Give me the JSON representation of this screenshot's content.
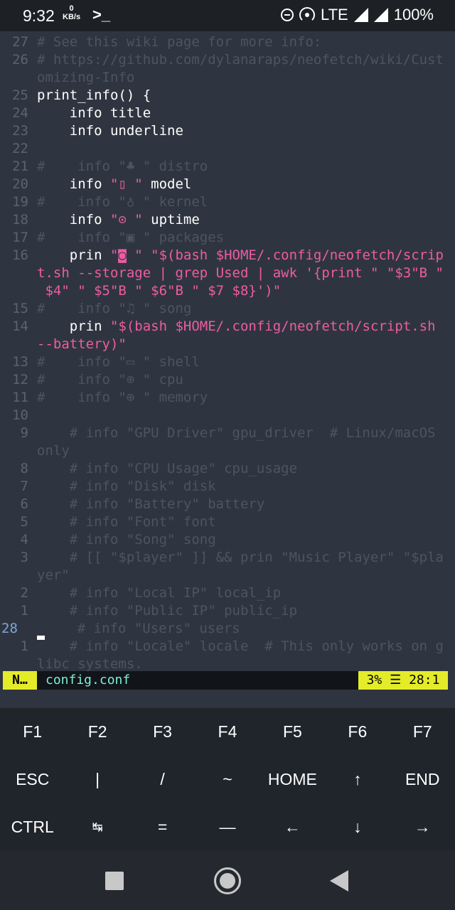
{
  "status": {
    "time": "9:32",
    "kbs_value": "0",
    "kbs_unit": "KB/s",
    "terminal_glyph": ">_",
    "network": "LTE",
    "battery": "100%"
  },
  "editor": {
    "lines": [
      {
        "n": "27",
        "t": "# See this wiki page for more info:",
        "s": "com"
      },
      {
        "n": "26",
        "t": "# https://github.com/dylanaraps/neofetch/wiki/Cust",
        "s": "com"
      },
      {
        "n": "",
        "t": "omizing-Info",
        "s": "com"
      },
      {
        "n": "25",
        "t": "print_info() {",
        "s": "code"
      },
      {
        "n": "24",
        "t": "    info title",
        "s": "code"
      },
      {
        "n": "23",
        "t": "    info underline",
        "s": "code"
      },
      {
        "n": "22",
        "t": "",
        "s": "code"
      },
      {
        "n": "21",
        "t": "#    info \"♣ \" distro",
        "s": "com"
      },
      {
        "n": "20",
        "pre": "    info ",
        "str": "\"▯ \"",
        "post": " model",
        "s": "mix"
      },
      {
        "n": "19",
        "t": "#    info \"♁ \" kernel",
        "s": "com"
      },
      {
        "n": "18",
        "pre": "    info ",
        "str": "\"⊙ \"",
        "post": " uptime",
        "s": "mix"
      },
      {
        "n": "17",
        "t": "#    info \"▣ \" packages",
        "s": "com"
      },
      {
        "n": "16",
        "pre": "    prin ",
        "str": "\"◙ \" \"$(bash $HOME/.config/neofetch/scrip",
        "post": "",
        "s": "mix"
      },
      {
        "n": "",
        "t": "t.sh --storage | grep Used | awk '{print \" \"$3\"B \"",
        "s": "str"
      },
      {
        "n": "",
        "t": " $4\" \" $5\"B \" $6\"B \" $7 $8}')\"",
        "s": "str"
      },
      {
        "n": "15",
        "t": "#    info \"♫ \" song",
        "s": "com"
      },
      {
        "n": "14",
        "pre": "    prin ",
        "str": "\"$(bash $HOME/.config/neofetch/script.sh",
        "post": "",
        "s": "mix"
      },
      {
        "n": "",
        "t": "--battery)\"",
        "s": "str"
      },
      {
        "n": "13",
        "t": "#    info \"▭ \" shell",
        "s": "com"
      },
      {
        "n": "12",
        "t": "#    info \"⊕ \" cpu",
        "s": "com"
      },
      {
        "n": "11",
        "t": "#    info \"⊕ \" memory",
        "s": "com"
      },
      {
        "n": "10",
        "t": "",
        "s": "code"
      },
      {
        "n": "9",
        "t": "    # info \"GPU Driver\" gpu_driver  # Linux/macOS",
        "s": "com"
      },
      {
        "n": "",
        "t": "only",
        "s": "com"
      },
      {
        "n": "8",
        "t": "    # info \"CPU Usage\" cpu_usage",
        "s": "com"
      },
      {
        "n": "7",
        "t": "    # info \"Disk\" disk",
        "s": "com"
      },
      {
        "n": "6",
        "t": "    # info \"Battery\" battery",
        "s": "com"
      },
      {
        "n": "5",
        "t": "    # info \"Font\" font",
        "s": "com"
      },
      {
        "n": "4",
        "t": "    # info \"Song\" song",
        "s": "com"
      },
      {
        "n": "3",
        "t": "    # [[ \"$player\" ]] && prin \"Music Player\" \"$pla",
        "s": "com"
      },
      {
        "n": "",
        "t": "yer\"",
        "s": "com"
      },
      {
        "n": "2",
        "t": "    # info \"Local IP\" local_ip",
        "s": "com"
      },
      {
        "n": "1",
        "t": "    # info \"Public IP\" public_ip",
        "s": "com"
      },
      {
        "n": "28",
        "t": "    # info \"Users\" users",
        "s": "cur"
      },
      {
        "n": "1",
        "t": "    # info \"Locale\" locale  # This only works on g",
        "s": "com"
      },
      {
        "n": "",
        "t": "libc systems.",
        "s": "com"
      }
    ]
  },
  "modeline": {
    "mode": "N…",
    "filename": "config.conf",
    "position": "3% ☰ 28:1"
  },
  "keyboard": {
    "row1": [
      "F1",
      "F2",
      "F3",
      "F4",
      "F5",
      "F6",
      "F7"
    ],
    "row2": [
      "ESC",
      "|",
      "/",
      "~",
      "HOME",
      "↑",
      "END"
    ],
    "row3": [
      "CTRL",
      "↹",
      "=",
      "—",
      "←",
      "↓",
      "→"
    ]
  }
}
